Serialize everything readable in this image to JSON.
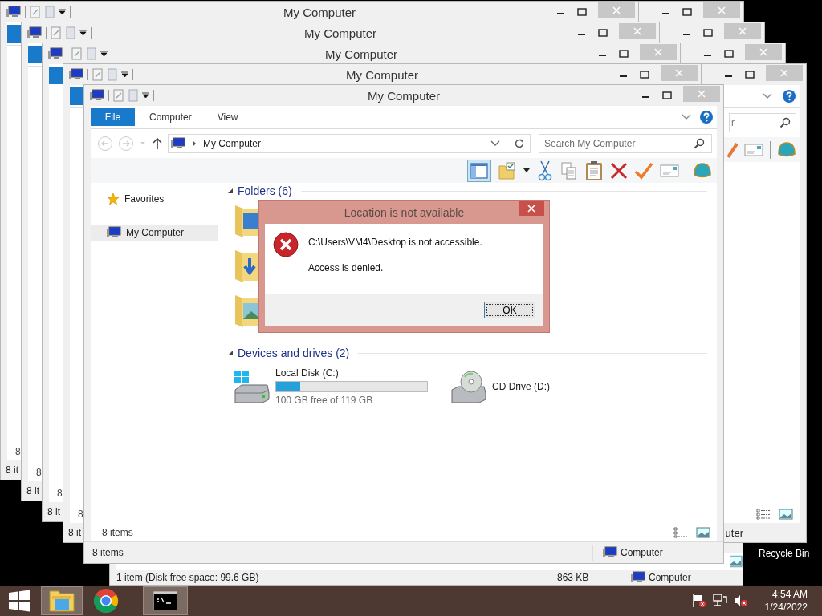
{
  "back_windows": [
    {
      "title": "My Computer",
      "count": "8",
      "status": "8 it"
    },
    {
      "title": "My Computer",
      "count": "8",
      "status": "8 it"
    },
    {
      "title": "My Computer",
      "count": "8",
      "status": "8 it"
    },
    {
      "title": "My Computer",
      "count": "8",
      "status": "8 it"
    }
  ],
  "side_windows": [
    {
      "kind": "title-only"
    },
    {
      "kind": "title-only"
    },
    {
      "kind": "title-only"
    },
    {
      "kind": "full",
      "search": "r",
      "status": "uter"
    }
  ],
  "bottom_window": {
    "status": "1 item (Disk free space: 99.6 GB)",
    "size": "863 KB",
    "location": "Computer"
  },
  "main_window": {
    "title": "My Computer",
    "ribbon_tabs": [
      {
        "label": "File",
        "selected": true
      },
      {
        "label": "Computer",
        "selected": false
      },
      {
        "label": "View",
        "selected": false
      }
    ],
    "address": "My Computer",
    "search_placeholder": "Search My Computer",
    "nav": [
      {
        "label": "Favorites",
        "kind": "favorites",
        "selected": false
      },
      {
        "label": "My Computer",
        "kind": "computer",
        "selected": true
      }
    ],
    "groups": [
      {
        "title": "Folders (6)"
      },
      {
        "title": "Devices and drives (2)"
      }
    ],
    "drives": [
      {
        "kind": "disk",
        "name": "Local Disk (C:)",
        "level": 0.16,
        "free": "100 GB free of 119 GB"
      },
      {
        "kind": "cd",
        "name": "CD Drive (D:)"
      }
    ],
    "content_status": "8 items",
    "status": "8 items",
    "status_location": "Computer"
  },
  "dialog": {
    "title": "Location is not available",
    "message": "C:\\Users\\VM4\\Desktop is not accessible.",
    "detail": "Access is denied.",
    "button": "OK"
  },
  "desktop": {
    "recycle_bin": "Recycle Bin"
  },
  "taskbar": {
    "apps": [
      {
        "kind": "explorer",
        "selected": true
      },
      {
        "kind": "chrome",
        "selected": false
      },
      {
        "kind": "cmd",
        "selected": true
      }
    ],
    "time": "4:54 AM",
    "date": "1/24/2022"
  }
}
